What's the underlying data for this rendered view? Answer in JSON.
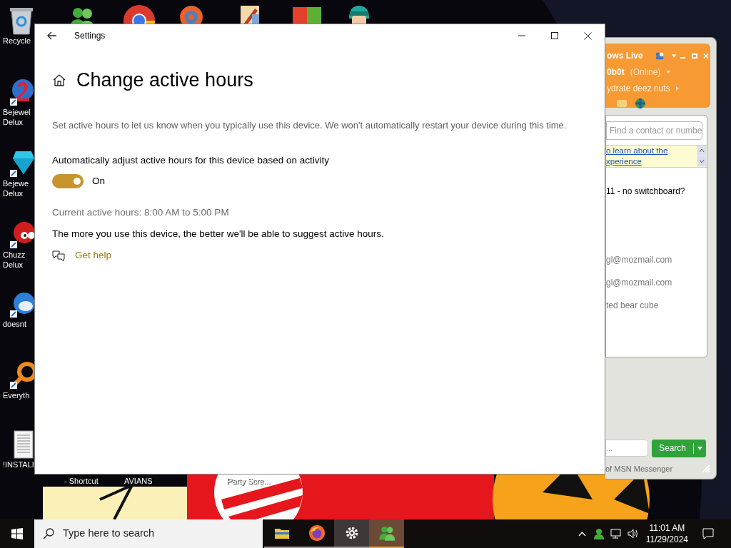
{
  "desktop": {
    "top_icons": [
      {
        "kind": "people"
      },
      {
        "kind": "chrome"
      },
      {
        "kind": "swirl"
      },
      {
        "kind": "paint"
      },
      {
        "kind": "office"
      },
      {
        "kind": "character"
      }
    ],
    "left_icons": [
      {
        "kind": "recycle",
        "lines": [
          "Recycle"
        ]
      },
      {
        "kind": "two",
        "lines": [
          "Bejewel",
          "Delux"
        ]
      },
      {
        "kind": "gem",
        "lines": [
          "Bejewe",
          "Delux"
        ]
      },
      {
        "kind": "fuzzball",
        "lines": [
          "Chuzz",
          "Delux"
        ]
      },
      {
        "kind": "bird",
        "lines": [
          "doesnt"
        ]
      },
      {
        "kind": "magnifier",
        "lines": [
          "Everyth"
        ]
      },
      {
        "kind": "document",
        "lines": [
          "!INSTALI"
        ]
      }
    ],
    "bottom_labels": [
      "- Shortcut",
      "AVIANS",
      "Party Scre..."
    ]
  },
  "settings": {
    "title": "Settings",
    "heading": "Change active hours",
    "description": "Set active hours to let us know when you typically use this device. We won't automatically restart your device during this time.",
    "toggle": {
      "label": "Automatically adjust active hours for this device based on activity",
      "on": true,
      "state_text": "On"
    },
    "current": "Current active hours: 8:00 AM to 5:00 PM",
    "note": "The more you use this device, the better we'll be able to suggest active hours.",
    "help_link": "Get help"
  },
  "messenger": {
    "title": "ows Live",
    "name": "0b0t",
    "status": "(Online)",
    "personal_message": "ydrate deez nuts",
    "search": {
      "placeholder": "Find a contact or numbe"
    },
    "notice": [
      "o learn about the",
      "xperience"
    ],
    "contacts": [
      "11 - no switchboard?",
      "gl@mozmail.com",
      "gl@mozmail.com",
      "ted bear cube"
    ],
    "bottom_field": {
      "placeholder": "..."
    },
    "search_button": "Search",
    "footer": "of MSN Messenger"
  },
  "taskbar": {
    "search": {
      "placeholder": "Type here to search"
    },
    "apps": [
      {
        "kind": "folder",
        "selected": false,
        "attention": false
      },
      {
        "kind": "firefox",
        "selected": false,
        "attention": false
      },
      {
        "kind": "gear",
        "selected": true,
        "attention": false
      },
      {
        "kind": "people",
        "selected": false,
        "attention": true
      }
    ],
    "time": "11:01 AM",
    "date": "11/29/2024"
  }
}
